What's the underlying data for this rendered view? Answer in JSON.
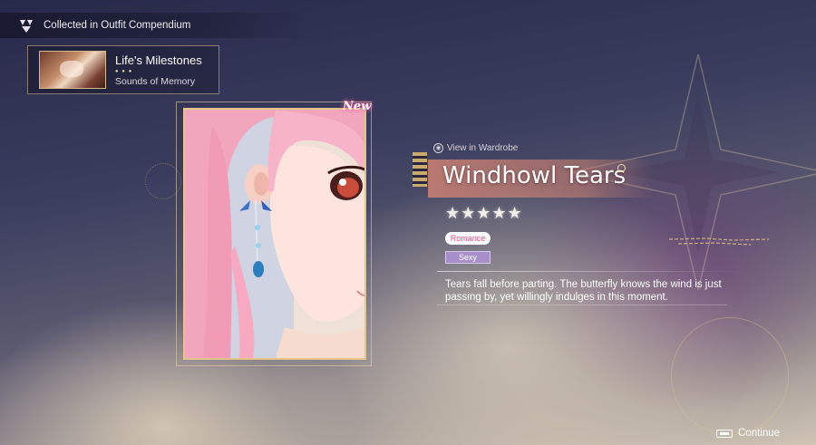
{
  "header": {
    "icon": "compendium-icon",
    "text": "Collected in Outfit Compendium"
  },
  "milestone": {
    "title": "Life's Milestones",
    "subtitle": "Sounds of Memory",
    "thumbnail": "milestone-thumbnail"
  },
  "card": {
    "badge": "New",
    "image": "pink-haired-girl-wearing-butterfly-earring"
  },
  "outfit": {
    "view_link": "View in Wardrobe",
    "name": "Windhowl Tears",
    "rating": 5,
    "stars": "★★★★★",
    "tags": [
      "Romance",
      "Sexy"
    ],
    "description": "Tears fall before parting. The butterfly knows the wind is just passing by, yet willingly indulges in this moment."
  },
  "footer": {
    "continue_label": "Continue",
    "icon": "continue-key-icon"
  },
  "colors": {
    "accent_gold": "#e4c58a",
    "title_banner": "#cd8273",
    "romance_tag": "#e8467a",
    "sexy_tag": "#a88ecb"
  }
}
